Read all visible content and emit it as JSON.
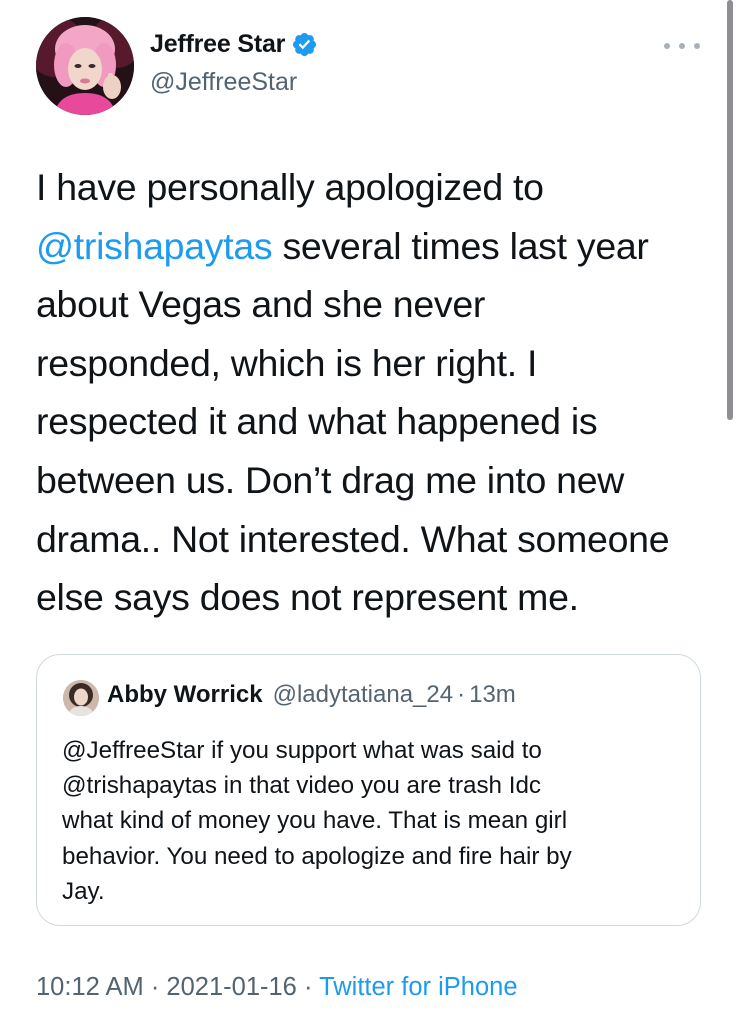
{
  "author": {
    "name": "Jeffree Star",
    "handle": "@JeffreeStar",
    "verified": true,
    "avatar_icon": "profile-photo"
  },
  "menu": {
    "icon": "more-horizontal-icon"
  },
  "tweet": {
    "lines": [
      {
        "text": "I have personally apologized to"
      },
      {
        "mention": "@trishapaytas",
        "text": " several times last year"
      },
      {
        "text": "about Vegas and she never"
      },
      {
        "text": "responded, which is her right. I"
      },
      {
        "text": "respected it and what happened is"
      },
      {
        "text": "between us. Don’t drag me into new"
      },
      {
        "text": "drama.. Not interested. What someone"
      },
      {
        "text": "else says does not represent me."
      }
    ]
  },
  "quote": {
    "name": "Abby Worrick",
    "handle": "@ladytatiana_24",
    "separator": "·",
    "time": "13m",
    "lines": [
      "@JeffreeStar if you support what was said to",
      "@trishapaytas in that video you are trash Idc",
      "what kind of money you have. That is mean girl",
      "behavior. You need to apologize and fire hair by",
      "Jay."
    ]
  },
  "meta": {
    "time": "10:12 AM",
    "sep1": " · ",
    "date": "2021-01-16",
    "sep2": " · ",
    "source": "Twitter for iPhone"
  },
  "colors": {
    "link": "#1d9bf0",
    "secondary_text": "#536471",
    "primary_text": "#0f1419",
    "border": "#cfd9de"
  }
}
